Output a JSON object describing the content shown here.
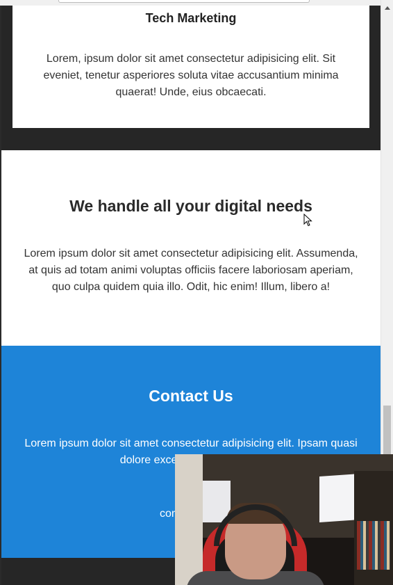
{
  "service_card": {
    "title": "Tech Marketing",
    "text": "Lorem, ipsum dolor sit amet consectetur adipisicing elit. Sit eveniet, tenetur asperiores soluta vitae accusantium minima quaerat! Unde, eius obcaecati."
  },
  "digital_section": {
    "title": "We handle all your digital needs",
    "text": "Lorem ipsum dolor sit amet consectetur adipisicing elit. Assumenda, at quis ad totam animi voluptas officiis facere laboriosam aperiam, quo culpa quidem quia illo. Odit, hic enim! Illum, libero a!"
  },
  "contact_section": {
    "title": "Contact Us",
    "text": "Lorem ipsum dolor sit amet consectetur adipisicing elit. Ipsam quasi dolore excepturi voluptates a",
    "email": "contact@acr"
  },
  "colors": {
    "dark_band": "#262626",
    "contact_blue": "#1e84d8",
    "card_bg": "#ffffff"
  },
  "icons": {
    "cursor": "arrow-cursor-icon",
    "scroll_up": "scroll-up-arrow-icon"
  }
}
